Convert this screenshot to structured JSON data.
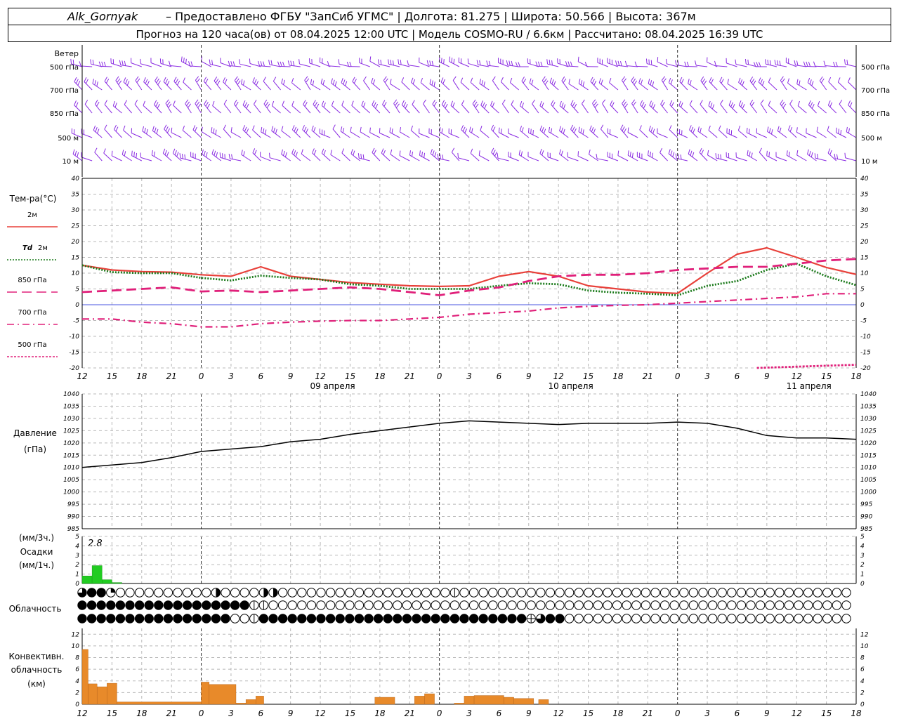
{
  "header": {
    "station": "Alk_Gornyak",
    "line1_rest": "– Предоставлено ФГБУ \"ЗапСиб УГМС\" | Долгота: 81.275 | Широта: 50.566 | Высота: 367м",
    "line2": "Прогноз на 120 часа(ов) от 08.04.2025 12:00 UTC  | Модель COSMO-RU / 6.6км | Рассчитано: 08.04.2025 16:39 UTC"
  },
  "wind_panel": {
    "title": "Ветер",
    "levels": [
      "500 гПа",
      "700 гПа",
      "850 гПа",
      "500 м",
      "10  м"
    ],
    "color": "#8a2be2"
  },
  "temp_panel": {
    "title": "Тем-ра(°C)",
    "legend": [
      {
        "label": "2м",
        "color": "#e8403a",
        "style": "solid"
      },
      {
        "label": "Td 2м",
        "color": "#1a7a1a",
        "style": "dotted"
      },
      {
        "label": "850 гПа",
        "color": "#e0207a",
        "style": "dashed"
      },
      {
        "label": "700 гПа",
        "color": "#e0207a",
        "style": "dashdot"
      },
      {
        "label": "500 гПа",
        "color": "#e0207a",
        "style": "dense-dash"
      }
    ],
    "yticks": [
      "40",
      "35",
      "30",
      "25",
      "20",
      "15",
      "10",
      "5",
      "0",
      "-5",
      "-10",
      "-15",
      "-20"
    ]
  },
  "time_axis": {
    "hour_labels": [
      "12",
      "15",
      "18",
      "21",
      "0",
      "3",
      "6",
      "9",
      "12",
      "15",
      "18",
      "21",
      "0",
      "3",
      "6",
      "9",
      "12",
      "15",
      "18",
      "21",
      "0",
      "3",
      "6",
      "9",
      "12",
      "15",
      "18"
    ],
    "dates": [
      {
        "label": "09 апреля",
        "hour_index": 12
      },
      {
        "label": "10 апреля",
        "hour_index": 36
      },
      {
        "label": "11 апреля",
        "hour_index": 60
      }
    ]
  },
  "pressure_panel": {
    "title": "Давление",
    "unit": "(гПа)",
    "yticks": [
      "1040",
      "1035",
      "1030",
      "1025",
      "1020",
      "1015",
      "1010",
      "1005",
      "1000",
      "995",
      "990",
      "985"
    ]
  },
  "precip_panel": {
    "unit_top": "(мм/3ч.)",
    "title": "Осадки",
    "unit_bottom": "(мм/1ч.)",
    "total_label": "2.8",
    "yticks": [
      "5",
      "4",
      "3",
      "2",
      "1",
      "0"
    ],
    "color": "#22cc22"
  },
  "cloud_panel": {
    "title": "Облачность"
  },
  "conv_panel": {
    "title_l1": "Конвективн.",
    "title_l2": "облачность",
    "unit": "(км)",
    "yticks": [
      "12",
      "10",
      "8",
      "6",
      "4",
      "2",
      "0"
    ],
    "color": "#e88a2a"
  },
  "chart_data": {
    "type": "meteogram",
    "x_unit": "hours since 08.04.2025 12:00 UTC",
    "x_range": [
      0,
      78
    ],
    "temperature": {
      "ylim": [
        -20,
        40
      ],
      "series": [
        {
          "name": "2м",
          "x": [
            0,
            3,
            6,
            9,
            12,
            15,
            18,
            21,
            24,
            27,
            30,
            33,
            36,
            39,
            42,
            45,
            48,
            51,
            54,
            57,
            60,
            63,
            66,
            69,
            72,
            75,
            78
          ],
          "values": [
            12.5,
            11,
            10.5,
            10.3,
            9.5,
            9,
            12,
            9,
            8,
            7,
            6.5,
            6,
            5.8,
            6,
            9,
            10.5,
            9,
            6,
            5,
            4,
            3.6,
            10,
            16,
            18,
            15,
            11.8,
            9.6
          ]
        },
        {
          "name": "Td 2м",
          "x": [
            0,
            3,
            6,
            9,
            12,
            15,
            18,
            21,
            24,
            27,
            30,
            33,
            36,
            39,
            42,
            45,
            48,
            51,
            54,
            57,
            60,
            63,
            66,
            69,
            72,
            75,
            78
          ],
          "values": [
            12.5,
            10.3,
            10,
            10,
            8.5,
            7.7,
            9.2,
            8.5,
            8,
            6.5,
            6,
            5,
            5,
            5,
            6,
            6.8,
            6.5,
            4.5,
            3.8,
            3.5,
            3,
            6,
            7.5,
            11,
            13,
            9,
            6.2
          ]
        },
        {
          "name": "850 гПа",
          "x": [
            0,
            3,
            6,
            9,
            12,
            15,
            18,
            21,
            24,
            27,
            30,
            33,
            36,
            39,
            42,
            45,
            48,
            51,
            54,
            57,
            60,
            63,
            66,
            69,
            72,
            75,
            78
          ],
          "values": [
            4,
            4.5,
            5,
            5.5,
            4.2,
            4.5,
            4,
            4.5,
            5,
            5.5,
            5,
            4,
            3,
            4.5,
            5.5,
            7.5,
            9,
            9.5,
            9.5,
            10,
            11,
            11.5,
            12,
            12,
            13,
            14,
            14.5
          ]
        },
        {
          "name": "700 гПа",
          "x": [
            0,
            3,
            6,
            9,
            12,
            15,
            18,
            21,
            24,
            27,
            30,
            33,
            36,
            39,
            42,
            45,
            48,
            51,
            54,
            57,
            60,
            63,
            66,
            69,
            72,
            75,
            78
          ],
          "values": [
            -4.5,
            -4.5,
            -5.5,
            -6,
            -7,
            -7,
            -6,
            -5.5,
            -5.2,
            -5,
            -5,
            -4.5,
            -4,
            -3,
            -2.5,
            -2,
            -1,
            -0.5,
            -0.2,
            0,
            0.5,
            1,
            1.5,
            2,
            2.5,
            3.5,
            3.5
          ]
        },
        {
          "name": "500 гПа",
          "x": [
            68,
            70,
            72,
            74,
            76,
            78
          ],
          "values": [
            -20,
            -19.8,
            -19.6,
            -19.4,
            -19.2,
            -19
          ]
        }
      ]
    },
    "pressure": {
      "ylim": [
        985,
        1040
      ],
      "x": [
        0,
        3,
        6,
        9,
        12,
        15,
        18,
        21,
        24,
        27,
        30,
        33,
        36,
        39,
        42,
        45,
        48,
        51,
        54,
        57,
        60,
        63,
        66,
        69,
        72,
        75,
        78
      ],
      "values": [
        1010,
        1011,
        1012,
        1014,
        1016.5,
        1017.5,
        1018.5,
        1020.5,
        1021.5,
        1023.5,
        1025,
        1026.5,
        1028,
        1029,
        1028.5,
        1028,
        1027.5,
        1028,
        1028,
        1028,
        1028.5,
        1028,
        1026,
        1023,
        1022,
        1022,
        1021.5
      ]
    },
    "precipitation": {
      "ylim": [
        0,
        5
      ],
      "x": [
        0,
        1,
        2,
        3
      ],
      "values": [
        0.8,
        1.9,
        0.4,
        0.1
      ]
    },
    "convective_cloud": {
      "ylim": [
        0,
        13
      ],
      "bars": [
        {
          "x0": 0,
          "x1": 0.6,
          "value": 9.4
        },
        {
          "x0": 0.6,
          "x1": 1.5,
          "value": 3.5
        },
        {
          "x0": 1.5,
          "x1": 2.5,
          "value": 3
        },
        {
          "x0": 2.5,
          "x1": 3.5,
          "value": 3.6
        },
        {
          "x0": 3.5,
          "x1": 12,
          "value": 0.4
        },
        {
          "x0": 12,
          "x1": 12.8,
          "value": 3.8
        },
        {
          "x0": 12.8,
          "x1": 15.5,
          "value": 3.4
        },
        {
          "x0": 15.5,
          "x1": 16.5,
          "value": 0.2
        },
        {
          "x0": 16.5,
          "x1": 17.5,
          "value": 0.8
        },
        {
          "x0": 17.5,
          "x1": 18.3,
          "value": 1.4
        },
        {
          "x0": 29.5,
          "x1": 31.5,
          "value": 1.2
        },
        {
          "x0": 33.5,
          "x1": 34.5,
          "value": 1.4
        },
        {
          "x0": 34.5,
          "x1": 35.5,
          "value": 1.8
        },
        {
          "x0": 37.5,
          "x1": 38.5,
          "value": 0.2
        },
        {
          "x0": 38.5,
          "x1": 39.5,
          "value": 1.4
        },
        {
          "x0": 39.5,
          "x1": 42.5,
          "value": 1.5
        },
        {
          "x0": 42.5,
          "x1": 43.5,
          "value": 1.2
        },
        {
          "x0": 43.5,
          "x1": 45.5,
          "value": 1
        },
        {
          "x0": 46,
          "x1": 47,
          "value": 0.8
        }
      ]
    },
    "cloudiness": {
      "rows": [
        "GBBQEEEEEEEEEEHEEEEPPEEEEEEEEEEEEEEEEEEFEEEEEEEEEEEEEEEEEEEEEEEEEEEEEEEEEEEEEEEEE",
        "BBBBBBBBBBBBBBBBBBFFEEEEEEEEEEEEEEEEEEEEEEEEEEEEEEEEEEEEEEEEEEEEEEEEEEEEEEEEEEEEE",
        "BBBBBBBBBBBBBBBBEEFBBBBBBBBBBBBBBBBBBBBBBBBBBBBXGBBEEEEEEEEEEEEEEEEEEEEEEEEEEEEEE"
      ],
      "legend_codes": {
        "E": "clear",
        "Q": "quarter",
        "H": "half",
        "G": "three-quarter",
        "B": "overcast",
        "P": "partial",
        "F": "fog",
        "X": "cross"
      }
    },
    "wind": {
      "levels": [
        "500 гПа",
        "700 гПа",
        "850 гПа",
        "500 м",
        "10  м"
      ],
      "direction_deg_summary": {
        "500 гПа": [
          270,
          300
        ],
        "700 гПа": [
          300,
          330
        ],
        "850 гПа": [
          310,
          330
        ],
        "500 м": [
          290,
          320
        ],
        "10  м": [
          280,
          320
        ]
      }
    }
  }
}
